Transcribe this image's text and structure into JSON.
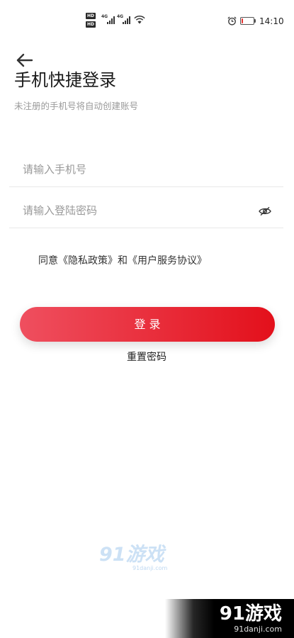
{
  "status_bar": {
    "hd_label_1": "HD",
    "hd_label_2": "HD",
    "network_1": "4G",
    "network_2": "4G",
    "time": "14:10",
    "battery_level": 0.1,
    "icons": [
      "hd-icon",
      "signal-icon",
      "signal-icon",
      "wifi-icon",
      "alarm-icon",
      "battery-icon"
    ]
  },
  "header": {
    "back_icon": "arrow-left-icon",
    "title": "手机快捷登录",
    "subtitle": "未注册的手机号将自动创建账号"
  },
  "form": {
    "phone": {
      "value": "",
      "placeholder": "请输入手机号"
    },
    "password": {
      "value": "",
      "placeholder": "请输入登陆密码",
      "toggle_icon": "eye-off-icon"
    },
    "agreement": {
      "prefix": "同意",
      "privacy_link": "《隐私政策》",
      "conjunction": "和",
      "terms_link": "《用户服务协议》"
    },
    "login_label": "登 录",
    "reset_label": "重置密码"
  },
  "watermark": {
    "brand": "91游戏",
    "site": "91danji.com",
    "corner_brand": "91游戏",
    "corner_site": "91danji.com"
  },
  "colors": {
    "accent_start": "#ef4f5f",
    "accent_end": "#e3101b",
    "battery_low": "#e8312f",
    "watermark_blue": "#bcd8f2"
  }
}
